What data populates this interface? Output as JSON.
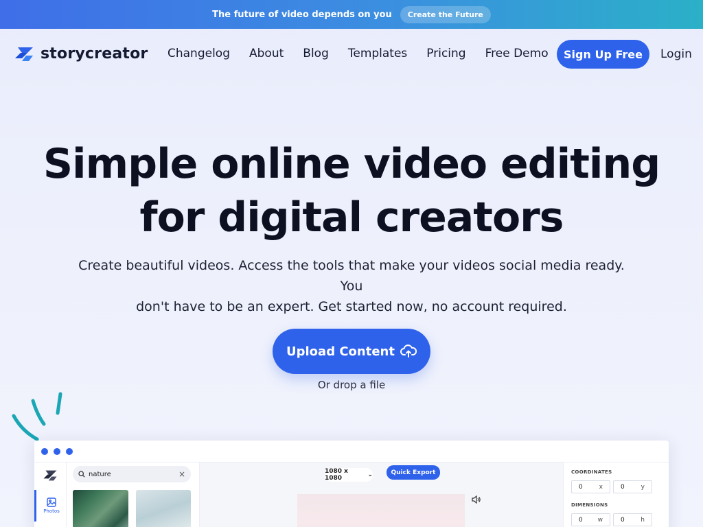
{
  "banner": {
    "text": "The future of video depends on you",
    "button": "Create the Future"
  },
  "nav": {
    "logo_text": "storycreator",
    "links": [
      "Changelog",
      "About",
      "Blog",
      "Templates",
      "Pricing",
      "Free Demo"
    ],
    "signup": "Sign Up Free",
    "login": "Login"
  },
  "hero": {
    "title_line1": "Simple online video editing",
    "title_line2": "for digital creators",
    "subtitle_line1": "Create beautiful videos. Access the tools that make your videos social media ready. You",
    "subtitle_line2": "don't have to be an expert. Get started now, no account required.",
    "upload_label": "Upload Content",
    "drop_text": "Or drop a file"
  },
  "editor": {
    "rail_photos_label": "Photos",
    "search_value": "nature",
    "dims_label": "1080 x 1080",
    "export_label": "Quick Export",
    "coordinates_label": "COORDINATES",
    "coord_x": "0",
    "coord_x_suffix": "x",
    "coord_y": "0",
    "coord_y_suffix": "y",
    "dimensions_label": "DIMENSIONS",
    "dim_w": "0",
    "dim_w_suffix": "w",
    "dim_h": "0",
    "dim_h_suffix": "h"
  },
  "colors": {
    "accent": "#2f62eb",
    "banner_start": "#3f6ee8",
    "banner_end": "#2bb0c8",
    "doodle": "#1aa6b4"
  }
}
